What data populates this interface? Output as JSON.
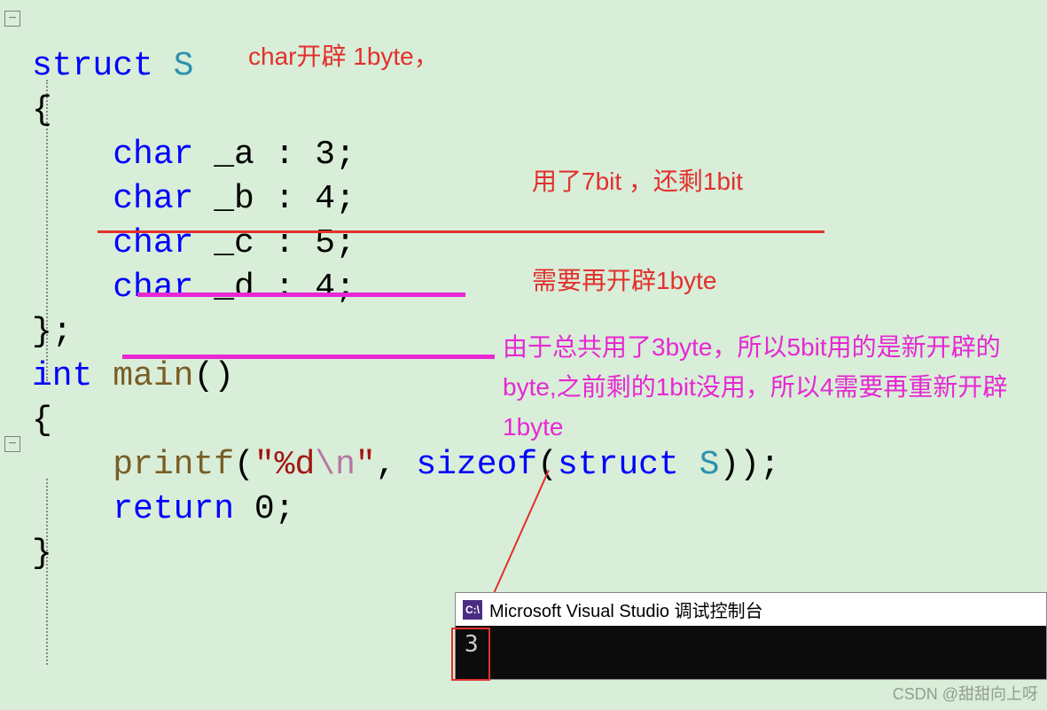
{
  "code": {
    "l1_kw": "struct",
    "l1_type": " S",
    "l2": "{",
    "l3_kw": "char",
    "l3_rest": " _a : 3;",
    "l4_kw": "char",
    "l4_rest": " _b : 4;",
    "l5_kw": "char",
    "l5_rest": " _c : 5;",
    "l6_kw": "char",
    "l6_rest": " _d : 4;",
    "l7": "};",
    "l8_kw": "int",
    "l8_func": " main",
    "l8_paren": "()",
    "l9": "{",
    "l10_func": "printf",
    "l10_open": "(",
    "l10_str1": "\"%d",
    "l10_esc": "\\n",
    "l10_str2": "\"",
    "l10_comma": ", ",
    "l10_sizeof": "sizeof",
    "l10_paren2": "(",
    "l10_struct": "struct",
    "l10_typeS": " S",
    "l10_close": "));",
    "l11_kw": "return",
    "l11_rest": " 0;",
    "l12": "}"
  },
  "annotations": {
    "top_red": "char开辟 1byte，",
    "mid_red": "用了7bit ，还剩1bit",
    "mid_red2": "需要再开辟1byte",
    "magenta": "由于总共用了3byte，所以5bit用的是新开辟的byte,之前剩的1bit没用，所以4需要再重新开辟1byte"
  },
  "console": {
    "title": "Microsoft Visual Studio 调试控制台",
    "output": "3"
  },
  "watermark": "CSDN @甜甜向上呀"
}
